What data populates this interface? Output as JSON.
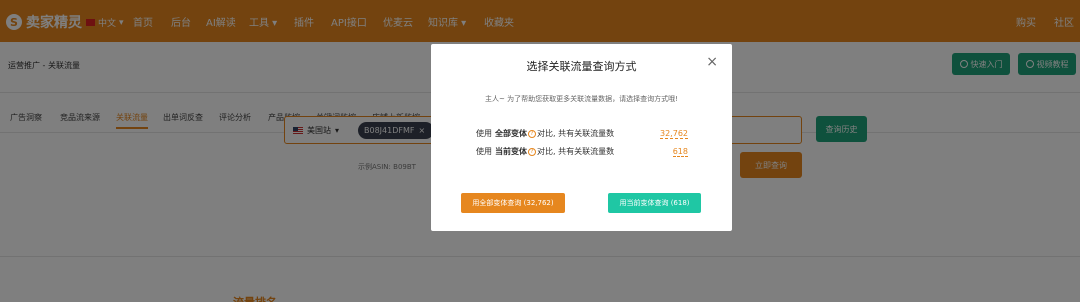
{
  "topnav": {
    "logo_mark": "S",
    "logo": "卖家精灵",
    "lang": "中文",
    "items": [
      "首页",
      "后台",
      "AI解读",
      "工具",
      "插件",
      "API接口",
      "优麦云",
      "知识库",
      "收藏夹"
    ],
    "right": [
      "购买",
      "社区"
    ]
  },
  "page": {
    "breadcrumb": "运营推广 - 关联流量",
    "quick_start": "快速入门",
    "video_tutorial": "视频教程",
    "tabs": [
      "广告洞察",
      "竞品流来源",
      "关联流量",
      "出单词反查",
      "评论分析",
      "产品监控",
      "关键词监控",
      "店铺上新监控"
    ],
    "site": "美国站",
    "asin_chip": "B08J41DFMF",
    "history_button": "查询历史",
    "example": "示例ASIN:",
    "example_value": "B09BT",
    "query_button": "立即查询",
    "section_title": "流量排名"
  },
  "modal": {
    "title": "选择关联流量查询方式",
    "close": "×",
    "desc": "主人~ 为了帮助您获取更多关联流量数据，请选择查询方式哦!",
    "row1": {
      "prefix": "使用",
      "variant": "全部变体",
      "suffix": "对比, 共有关联流量数",
      "count": "32,762"
    },
    "row2": {
      "prefix": "使用",
      "variant": "当前变体",
      "suffix": "对比, 共有关联流量数",
      "count": "618"
    },
    "btn_all": "用全部变体查询 (32,762)",
    "btn_current": "用当前变体查询 (618)"
  },
  "colors": {
    "brand": "#e6871f",
    "green": "#1fa37a",
    "teal": "#1fc7a4"
  }
}
